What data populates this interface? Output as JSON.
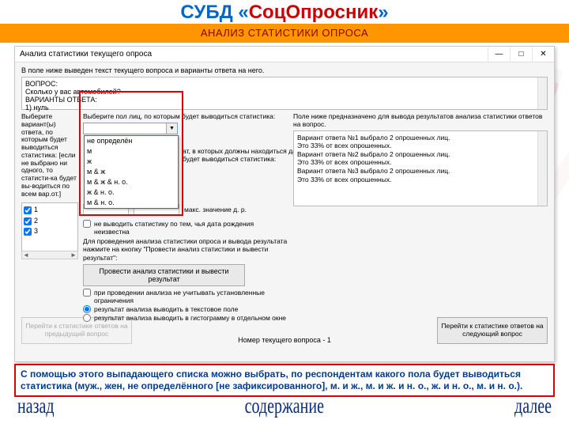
{
  "brand": {
    "pre": "СУБД «",
    "mid": "СоцОпросник",
    "post": "»"
  },
  "strip_title": "АНАЛИЗ СТАТИСТИКИ ОПРОСА",
  "window": {
    "title": "Анализ статистики текущего опроса",
    "min": "—",
    "max": "□",
    "close": "✕",
    "intro": "В поле ниже выведен текст текущего вопроса и варианты ответа на него.",
    "qa": {
      "q_label": "ВОПРОС:",
      "q_text": "Сколько у вас автомобилей?",
      "a_label": "ВАРИАНТЫ ОТВЕТА:",
      "a_text": "1) нуль"
    },
    "left_label": "Выберите вариант(ы) ответа, по которым будет выводиться статистика: [если не выбрано ни одного, то статисти-ка будет вы-водиться по всем вар.от.]",
    "checks": [
      "1",
      "2",
      "3"
    ],
    "gender_label": "Выберите пол лиц, по которым будет выводиться статистика:",
    "gender_options": [
      "",
      "не определён",
      "м",
      "ж",
      "м & ж",
      "м & ж & н. о.",
      "ж & н. о.",
      "м & н. о."
    ],
    "gender_selected": "",
    "dr_hint": "ат, в которых должны находиться даты орым будет выводиться статистика:",
    "dr_max_lbl": "макс. значение д. р.",
    "unknown_dob": "не выводить статистику по тем, чья дата рождения неизвестна",
    "run_hint": "Для проведения анализа статистики опроса и вывода результата нажмите на кнопку \"Провести анализ статистики и вывести результат\":",
    "run_btn": "Провести анализ статистики и вывести результат",
    "ignore_limits": "при проведении анализа не учитывать установленные ограничения",
    "out_text": "результат анализа выводить в текстовое поле",
    "out_hist": "результат анализа выводить в гистограмму в отдельном окне",
    "right_label": "Поле ниже предназначено для вывода результатов анализа статистики ответов на вопрос.",
    "results": [
      "Вариант ответа №1 выбрало 2 опрошенных лиц.",
      "Это 33% от всех опрошенных.",
      "Вариант ответа №2 выбрало 2 опрошенных лиц.",
      "Это 33% от всех опрошенных.",
      "Вариант ответа №3 выбрало 2 опрошенных лиц.",
      "Это 33% от всех опрошенных."
    ],
    "prev_btn": "Перейти к статистике ответов на предыдущий вопрос",
    "cur_q": "Номер текущего вопроса - 1",
    "next_btn": "Перейти к статистике ответов на следующий вопрос"
  },
  "annotation": "С помощью этого выпадающего списка можно выбрать, по респондентам какого пола будет выводиться статистика (муж., жен, не определённого [не зафиксированного], м. и ж., м. и ж. и н. о., ж. и н. о., м. и н. о.).",
  "footer": {
    "back": "назад",
    "toc": "содержание",
    "next": "далее"
  }
}
